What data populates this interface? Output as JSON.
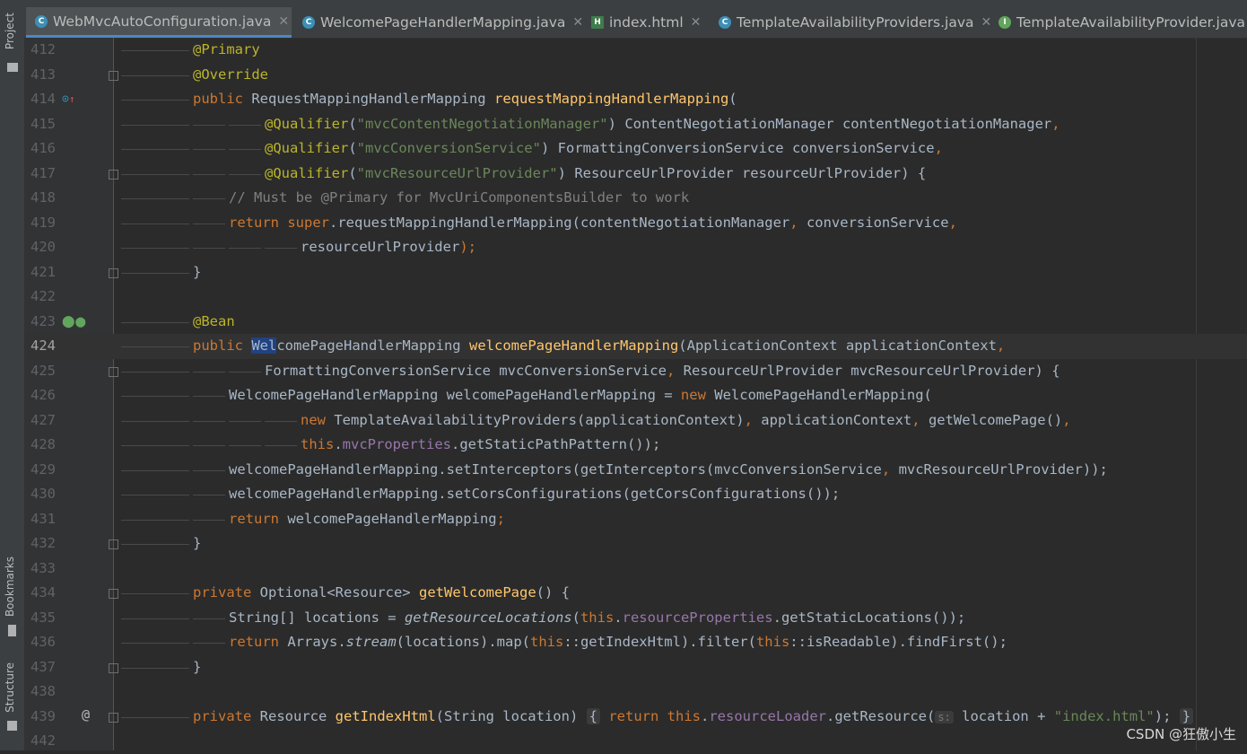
{
  "sidebar": {
    "project_label": "Project",
    "bookmarks_label": "Bookmarks",
    "structure_label": "Structure"
  },
  "tabs": [
    {
      "label": "WebMvcAutoConfiguration.java",
      "icon": "C",
      "active": true
    },
    {
      "label": "WelcomePageHandlerMapping.java",
      "icon": "C",
      "active": false
    },
    {
      "label": "index.html",
      "icon": "H",
      "active": false
    },
    {
      "label": "TemplateAvailabilityProviders.java",
      "icon": "C",
      "active": false
    },
    {
      "label": "TemplateAvailabilityProvider.java",
      "icon": "I",
      "active": false
    }
  ],
  "line_numbers": [
    "412",
    "413",
    "414",
    "415",
    "416",
    "417",
    "418",
    "419",
    "420",
    "421",
    "422",
    "423",
    "424",
    "425",
    "426",
    "427",
    "428",
    "429",
    "430",
    "431",
    "432",
    "433",
    "434",
    "435",
    "436",
    "437",
    "438",
    "439",
    "442"
  ],
  "current_line": "424",
  "code": {
    "t_primary": "@Primary",
    "t_override": "@Override",
    "t_public": "public",
    "t_private": "private",
    "t_return": "return",
    "t_new": "new",
    "t_this": "this",
    "t_super": "super",
    "t_qualifier": "@Qualifier",
    "t_bean": "@Bean",
    "t_rmhm_type": "RequestMappingHandlerMapping",
    "t_rmhm_name": "requestMappingHandlerMapping",
    "s_mvc_cn": "\"mvcContentNegotiationManager\"",
    "s_mvc_cs": "\"mvcConversionService\"",
    "s_mvc_ru": "\"mvcResourceUrlProvider\"",
    "t_cnm": "ContentNegotiationManager contentNegotiationManager",
    "t_fcs": "FormattingConversionService conversionService",
    "t_rup": "ResourceUrlProvider resourceUrlProvider",
    "comment_418": "// Must be @Primary for MvcUriComponentsBuilder to work",
    "t_call_419": ".requestMappingHandlerMapping(contentNegotiationManager",
    "t_args_419": " conversionService",
    "t_arg_420": "resourceUrlProvider",
    "t_wel_hl": "Wel",
    "t_wel_rest": "comePageHandlerMapping",
    "t_wphm_name": "welcomePageHandlerMapping",
    "t_appctx": "(ApplicationContext applicationContext",
    "t_params_425": "FormattingConversionService mvcConversionService",
    "t_params_425b": " ResourceUrlProvider mvcResourceUrlProvider) ",
    "t_decl_426": "WelcomePageHandlerMapping welcomePageHandlerMapping = ",
    "t_wphm_ctor": "WelcomePageHandlerMapping(",
    "t_tap": "TemplateAvailabilityProviders(applicationContext)",
    "t_427_rest": " applicationContext",
    "t_get_wp": " getWelcomePage()",
    "t_mvcprops": "mvcProperties",
    "t_static_path": ".getStaticPathPattern());",
    "t_429": "welcomePageHandlerMapping.setInterceptors(getInterceptors(mvcConversionService",
    "t_429b": " mvcResourceUrlProvider));",
    "t_430": "welcomePageHandlerMapping.setCorsConfigurations(getCorsConfigurations());",
    "t_431": " welcomePageHandlerMapping",
    "t_opt": "Optional<Resource>",
    "t_gwp": "getWelcomePage",
    "t_435a": "String[] locations = ",
    "t_435b": "getResourceLocations",
    "t_res_props": "resourceProperties",
    "t_435c": ".getStaticLocations());",
    "t_436a": "Arrays.",
    "t_stream": "stream",
    "t_436b": "(locations).map(",
    "t_436c": "::getIndexHtml).filter(",
    "t_436d": "::isReadable).findFirst();",
    "t_resource": "Resource",
    "t_gih": "getIndexHtml",
    "t_string_loc": "(String location) ",
    "t_res_loader": "resourceLoader",
    "t_get_res": ".getResource(",
    "hint_s": "s:",
    "t_loc_plus": " location + ",
    "s_index": "\"index.html\"",
    "t_end_439": ");",
    "t_brace_open": "{",
    "t_brace_close": "}",
    "t_paren_close": ");",
    "t_comma": ","
  },
  "watermark": "CSDN @狂傲小生"
}
